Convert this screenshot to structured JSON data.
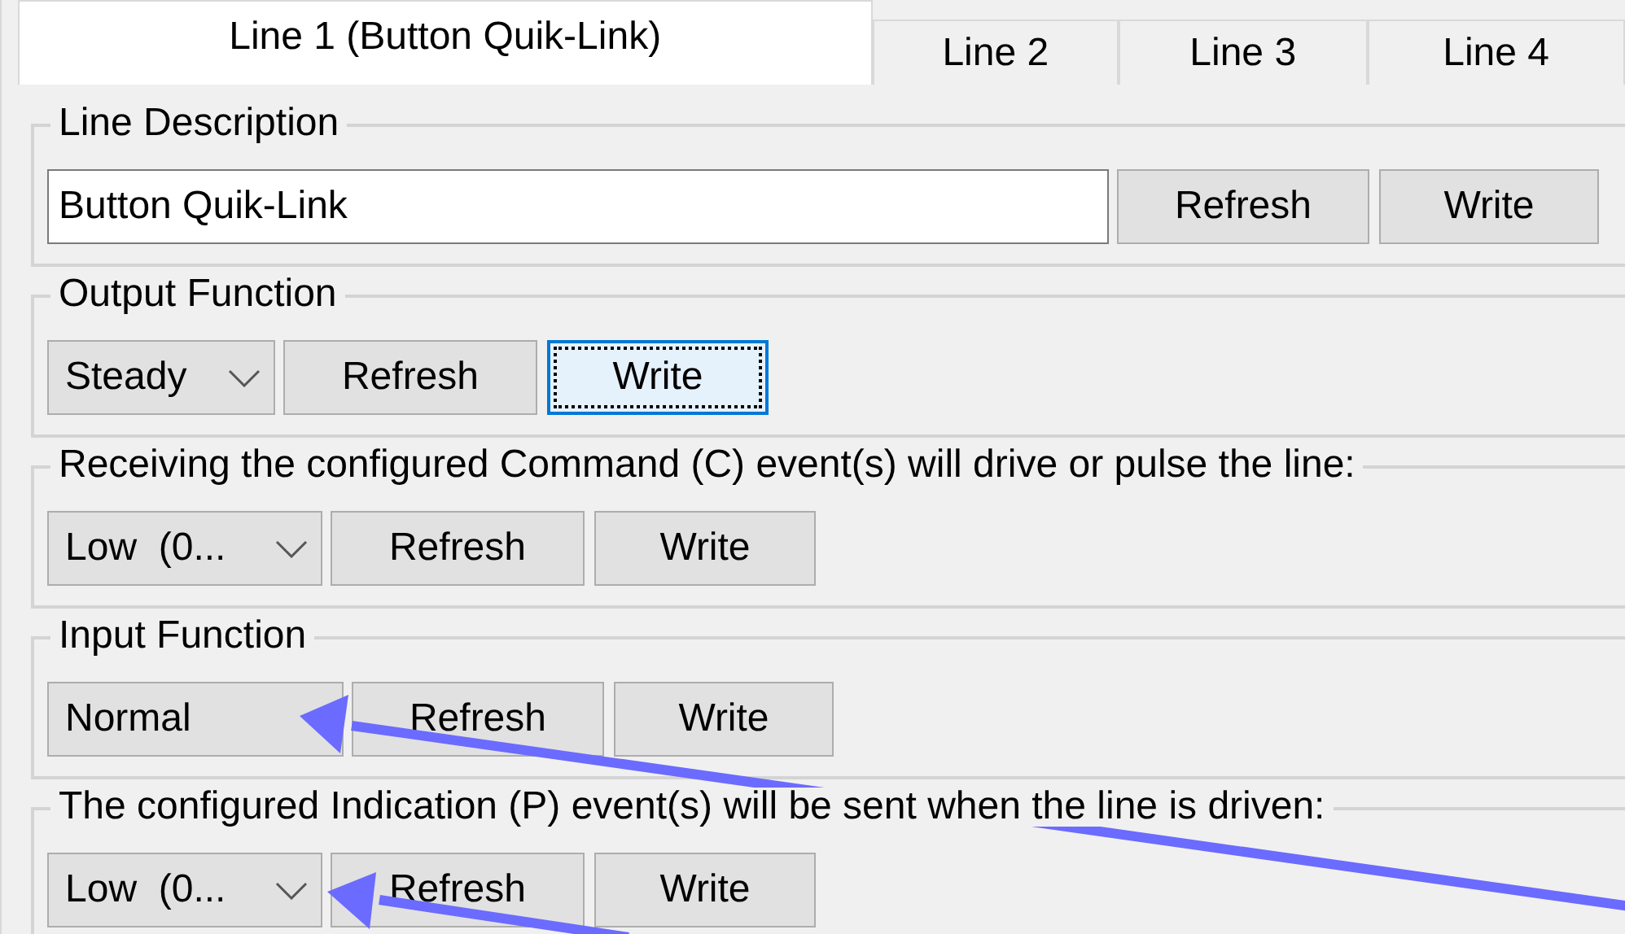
{
  "tabs": [
    {
      "label": "Line 1 (Button Quik-Link)",
      "selected": true
    },
    {
      "label": "Line 2",
      "selected": false
    },
    {
      "label": "Line 3",
      "selected": false
    },
    {
      "label": "Line 4",
      "selected": false
    }
  ],
  "groups": [
    {
      "legend": "Line Description",
      "control": {
        "kind": "field",
        "value": "Button Quik-Link"
      },
      "buttons": [
        {
          "label": "Refresh",
          "focused": false
        },
        {
          "label": "Write",
          "focused": false
        }
      ]
    },
    {
      "legend": "Output Function",
      "control": {
        "kind": "dropdown",
        "value": "Steady",
        "caret": true
      },
      "buttons": [
        {
          "label": "Refresh",
          "focused": false
        },
        {
          "label": "Write",
          "focused": true
        }
      ]
    },
    {
      "legend": "Receiving the configured Command (C) event(s) will drive or pulse the line:",
      "control": {
        "kind": "dropdown",
        "value": "Low  (0...",
        "caret": true
      },
      "buttons": [
        {
          "label": "Refresh",
          "focused": false
        },
        {
          "label": "Write",
          "focused": false
        }
      ]
    },
    {
      "legend": "Input Function",
      "control": {
        "kind": "dropdown",
        "value": "Normal",
        "caret": false
      },
      "buttons": [
        {
          "label": "Refresh",
          "focused": false
        },
        {
          "label": "Write",
          "focused": false
        }
      ]
    },
    {
      "legend": "The configured Indication (P) event(s) will be sent when the line is driven:",
      "control": {
        "kind": "dropdown",
        "value": "Low  (0...",
        "caret": true
      },
      "buttons": [
        {
          "label": "Refresh",
          "focused": false
        },
        {
          "label": "Write",
          "focused": false
        }
      ]
    }
  ]
}
